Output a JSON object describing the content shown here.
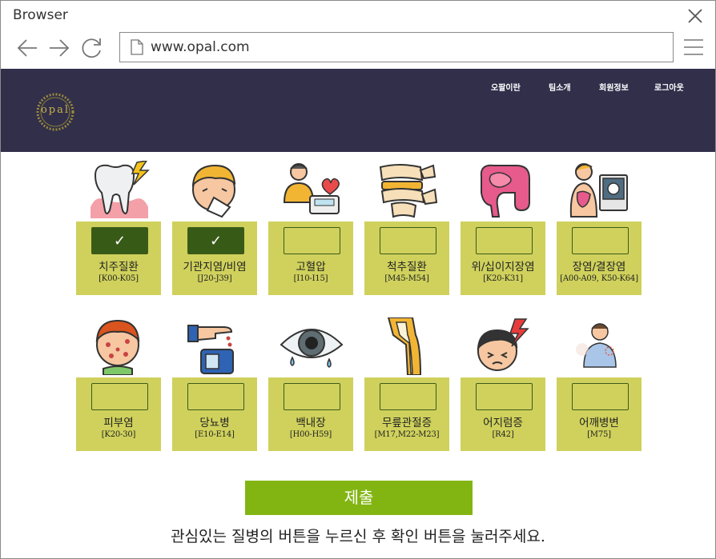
{
  "browser": {
    "title": "Browser",
    "url": "www.opal.com"
  },
  "site": {
    "logo_text": "opal",
    "nav": [
      "오팔이란",
      "팀소개",
      "회원정보",
      "로그아웃"
    ]
  },
  "diseases_row1": [
    {
      "name": "치주질환",
      "code": "[K00-K05]",
      "checked": true,
      "icon": "tooth-pain-icon"
    },
    {
      "name": "기관지염/비염",
      "code": "[J20-J39]",
      "checked": true,
      "icon": "sneezing-person-icon"
    },
    {
      "name": "고혈압",
      "code": "[I10-I15]",
      "checked": false,
      "icon": "blood-pressure-icon"
    },
    {
      "name": "척추질환",
      "code": "[M45-M54]",
      "checked": false,
      "icon": "spine-icon"
    },
    {
      "name": "위/십이지장염",
      "code": "[K20-K31]",
      "checked": false,
      "icon": "intestine-icon"
    },
    {
      "name": "장염/결장염",
      "code": "[A00-A09, K50-K64]",
      "checked": false,
      "icon": "endoscopy-icon"
    }
  ],
  "diseases_row2": [
    {
      "name": "피부염",
      "code": "[K20-30]",
      "checked": false,
      "icon": "skin-rash-icon"
    },
    {
      "name": "당뇨병",
      "code": "[E10-E14]",
      "checked": false,
      "icon": "glucose-meter-icon"
    },
    {
      "name": "백내장",
      "code": "[H00-H59]",
      "checked": false,
      "icon": "eye-icon"
    },
    {
      "name": "무릎관절증",
      "code": "[M17,M22-M23]",
      "checked": false,
      "icon": "knee-joint-icon"
    },
    {
      "name": "어지럼증",
      "code": "[R42]",
      "checked": false,
      "icon": "headache-icon"
    },
    {
      "name": "어깨병변",
      "code": "[M75]",
      "checked": false,
      "icon": "shoulder-pain-icon"
    }
  ],
  "submit_label": "제출",
  "instruction": "관심있는 질병의 버튼을 누르신 후 확인 버튼을 눌러주세요.",
  "colors": {
    "header_bg": "#322f4b",
    "card_bg": "#cfd15c",
    "checked_bg": "#385a17",
    "submit_bg": "#82b512"
  }
}
